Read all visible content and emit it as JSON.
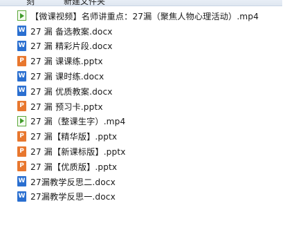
{
  "toolbar": {
    "left_label": "刻",
    "right_label": "新建文件夹"
  },
  "files": [
    {
      "type": "video",
      "icon": "video-file-icon",
      "name": "【微课视频】名师讲重点：27漏（聚焦人物心理活动）.mp4"
    },
    {
      "type": "word",
      "icon": "word-file-icon",
      "name": "27 漏 备选教案.docx"
    },
    {
      "type": "word",
      "icon": "word-file-icon",
      "name": "27 漏 精彩片段.docx"
    },
    {
      "type": "ppt",
      "icon": "ppt-file-icon",
      "name": "27 漏 课课练.pptx"
    },
    {
      "type": "word",
      "icon": "word-file-icon",
      "name": "27 漏 课时练.docx"
    },
    {
      "type": "word",
      "icon": "word-file-icon",
      "name": "27 漏 优质教案.docx"
    },
    {
      "type": "ppt",
      "icon": "ppt-file-icon",
      "name": "27 漏 预习卡.pptx"
    },
    {
      "type": "video",
      "icon": "video-file-icon",
      "name": "27 漏（整课生字）.mp4"
    },
    {
      "type": "ppt",
      "icon": "ppt-file-icon",
      "name": "27 漏【精华版】.pptx"
    },
    {
      "type": "ppt",
      "icon": "ppt-file-icon",
      "name": "27 漏【新课标版】.pptx"
    },
    {
      "type": "ppt",
      "icon": "ppt-file-icon",
      "name": "27 漏【优质版】.pptx"
    },
    {
      "type": "word",
      "icon": "word-file-icon",
      "name": "27漏教学反思二.docx"
    },
    {
      "type": "word",
      "icon": "word-file-icon",
      "name": "27漏教学反思一.docx"
    }
  ]
}
